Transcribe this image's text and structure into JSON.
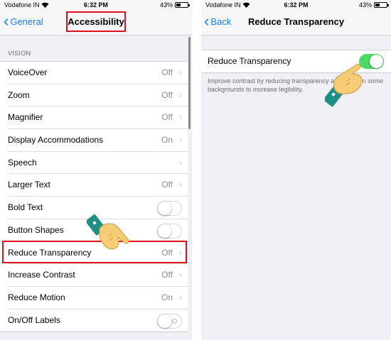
{
  "left_screen": {
    "status": {
      "carrier": "Vodafone IN",
      "time": "6:32 PM",
      "battery": "43%"
    },
    "nav": {
      "back_label": "General",
      "title": "Accessibility"
    },
    "section_header": "VISION",
    "rows": [
      {
        "label": "VoiceOver",
        "value": "Off"
      },
      {
        "label": "Zoom",
        "value": "Off"
      },
      {
        "label": "Magnifier",
        "value": "Off"
      },
      {
        "label": "Display Accommodations",
        "value": "On"
      },
      {
        "label": "Speech",
        "value": ""
      },
      {
        "label": "Larger Text",
        "value": "Off"
      },
      {
        "label": "Bold Text"
      },
      {
        "label": "Button Shapes"
      },
      {
        "label": "Reduce Transparency",
        "value": "Off"
      },
      {
        "label": "Increase Contrast",
        "value": "Off"
      },
      {
        "label": "Reduce Motion",
        "value": "On"
      },
      {
        "label": "On/Off Labels"
      }
    ]
  },
  "right_screen": {
    "status": {
      "carrier": "Vodafone IN",
      "time": "6:32 PM",
      "battery": "43%"
    },
    "nav": {
      "back_label": "Back",
      "title": "Reduce Transparency"
    },
    "setting_label": "Reduce Transparency",
    "footer": "Improve contrast by reducing transparency and blurs on some backgrounds to increase legibility."
  },
  "colors": {
    "accent": "#157efb",
    "highlight": "#e0101c",
    "switch_on": "#4cd964",
    "background": "#efeff4"
  },
  "icons": [
    "wifi-icon",
    "battery-icon",
    "chevron-left-icon",
    "chevron-right-icon",
    "pointing-hand-icon"
  ]
}
